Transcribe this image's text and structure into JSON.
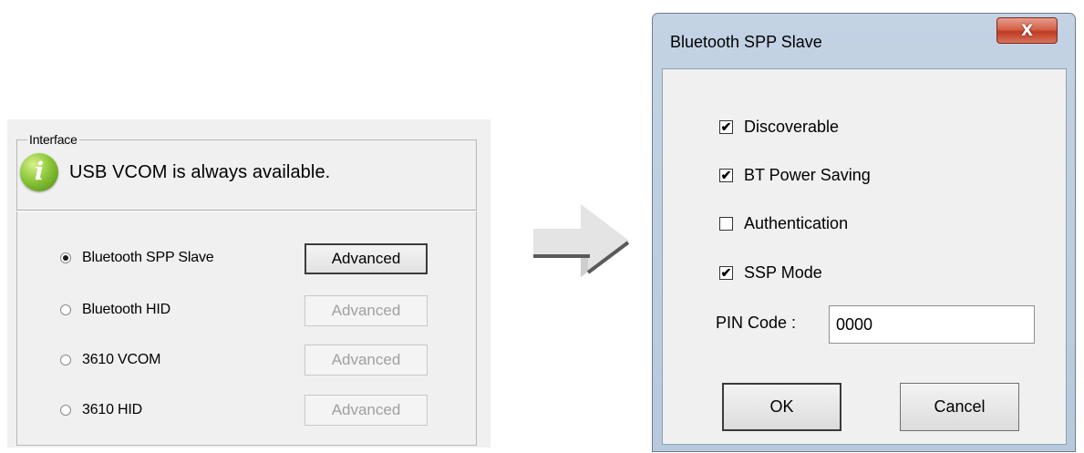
{
  "interface": {
    "legend": "Interface",
    "info_icon": "info-icon",
    "info_text": "USB VCOM is always available.",
    "options": [
      {
        "label": "Bluetooth SPP Slave",
        "selected": true,
        "button": "Advanced",
        "button_enabled": true
      },
      {
        "label": "Bluetooth HID",
        "selected": false,
        "button": "Advanced",
        "button_enabled": false
      },
      {
        "label": "3610 VCOM",
        "selected": false,
        "button": "Advanced",
        "button_enabled": false
      },
      {
        "label": "3610 HID",
        "selected": false,
        "button": "Advanced",
        "button_enabled": false
      }
    ]
  },
  "arrow_icon": "right-arrow-icon",
  "dialog": {
    "title": "Bluetooth SPP Slave",
    "close_label": "X",
    "checkboxes": [
      {
        "label": "Discoverable",
        "checked": true
      },
      {
        "label": "BT Power Saving",
        "checked": true
      },
      {
        "label": "Authentication",
        "checked": false
      },
      {
        "label": "SSP Mode",
        "checked": true
      }
    ],
    "pin_label": "PIN Code :",
    "pin_value": "0000",
    "ok_label": "OK",
    "cancel_label": "Cancel"
  }
}
